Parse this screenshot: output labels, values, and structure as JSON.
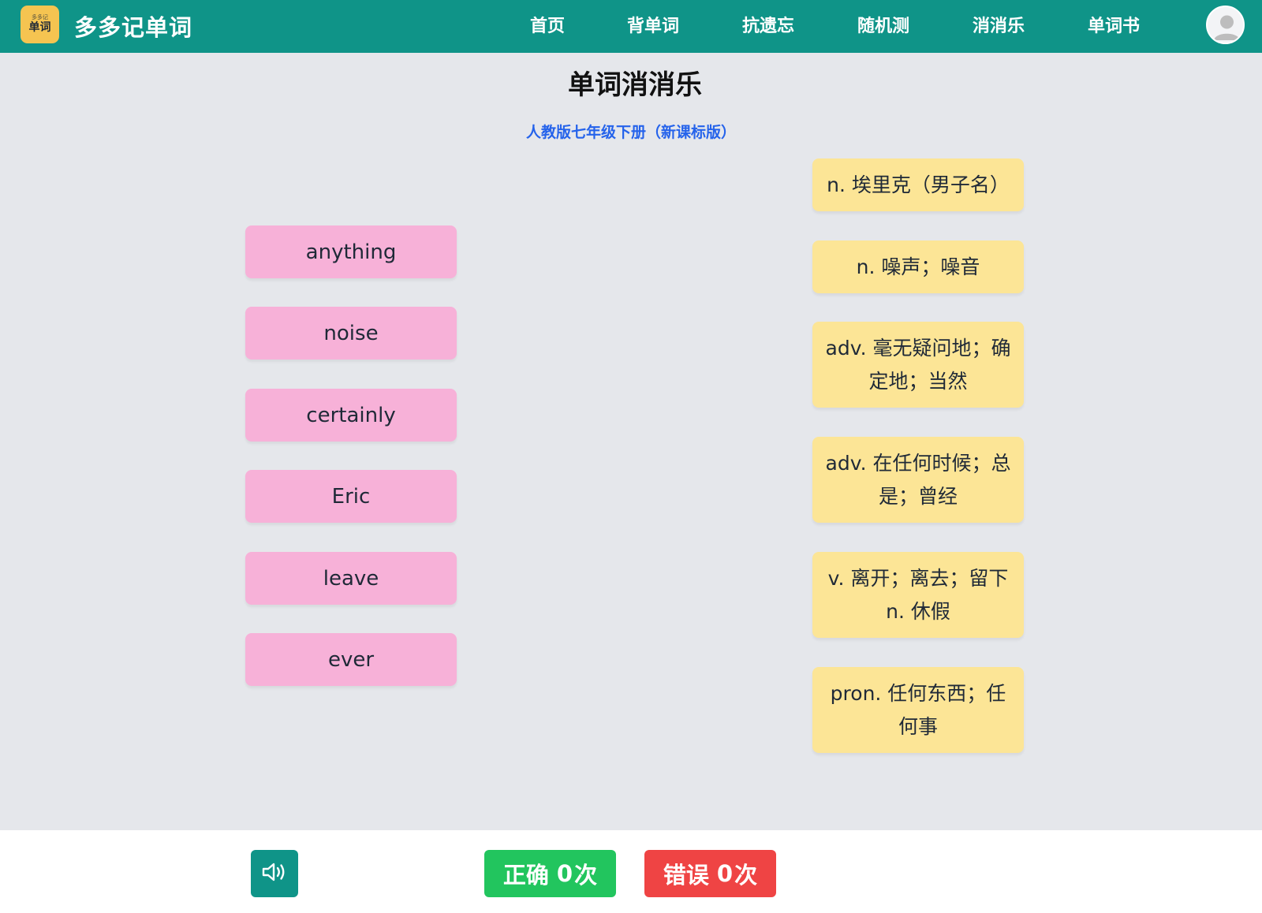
{
  "header": {
    "logo_small": "多多记",
    "logo_main": "单词",
    "app_title": "多多记单词",
    "nav": [
      "首页",
      "背单词",
      "抗遗忘",
      "随机测",
      "消消乐",
      "单词书"
    ],
    "avatar_icon": "user-avatar-icon"
  },
  "page": {
    "title": "单词消消乐",
    "subtitle": "人教版七年级下册（新课标版）"
  },
  "words": [
    "anything",
    "noise",
    "certainly",
    "Eric",
    "leave",
    "ever"
  ],
  "meanings": [
    "n. 埃里克（男子名）",
    "n. 噪声；噪音",
    "adv. 毫无疑问地；确定地；当然",
    "adv. 在任何时候；总是；曾经",
    "v. 离开；离去；留下n. 休假",
    "pron. 任何东西；任何事"
  ],
  "footer": {
    "sound_icon": "speaker-icon",
    "correct_label": "正确",
    "correct_count": "0",
    "correct_unit": "次",
    "wrong_label": "错误",
    "wrong_count": "0",
    "wrong_unit": "次"
  },
  "colors": {
    "header_bg": "#0f9488",
    "word_card": "#f7b1d8",
    "meaning_card": "#fce596",
    "correct": "#22c55e",
    "wrong": "#ef4444",
    "subtitle": "#2563eb"
  }
}
